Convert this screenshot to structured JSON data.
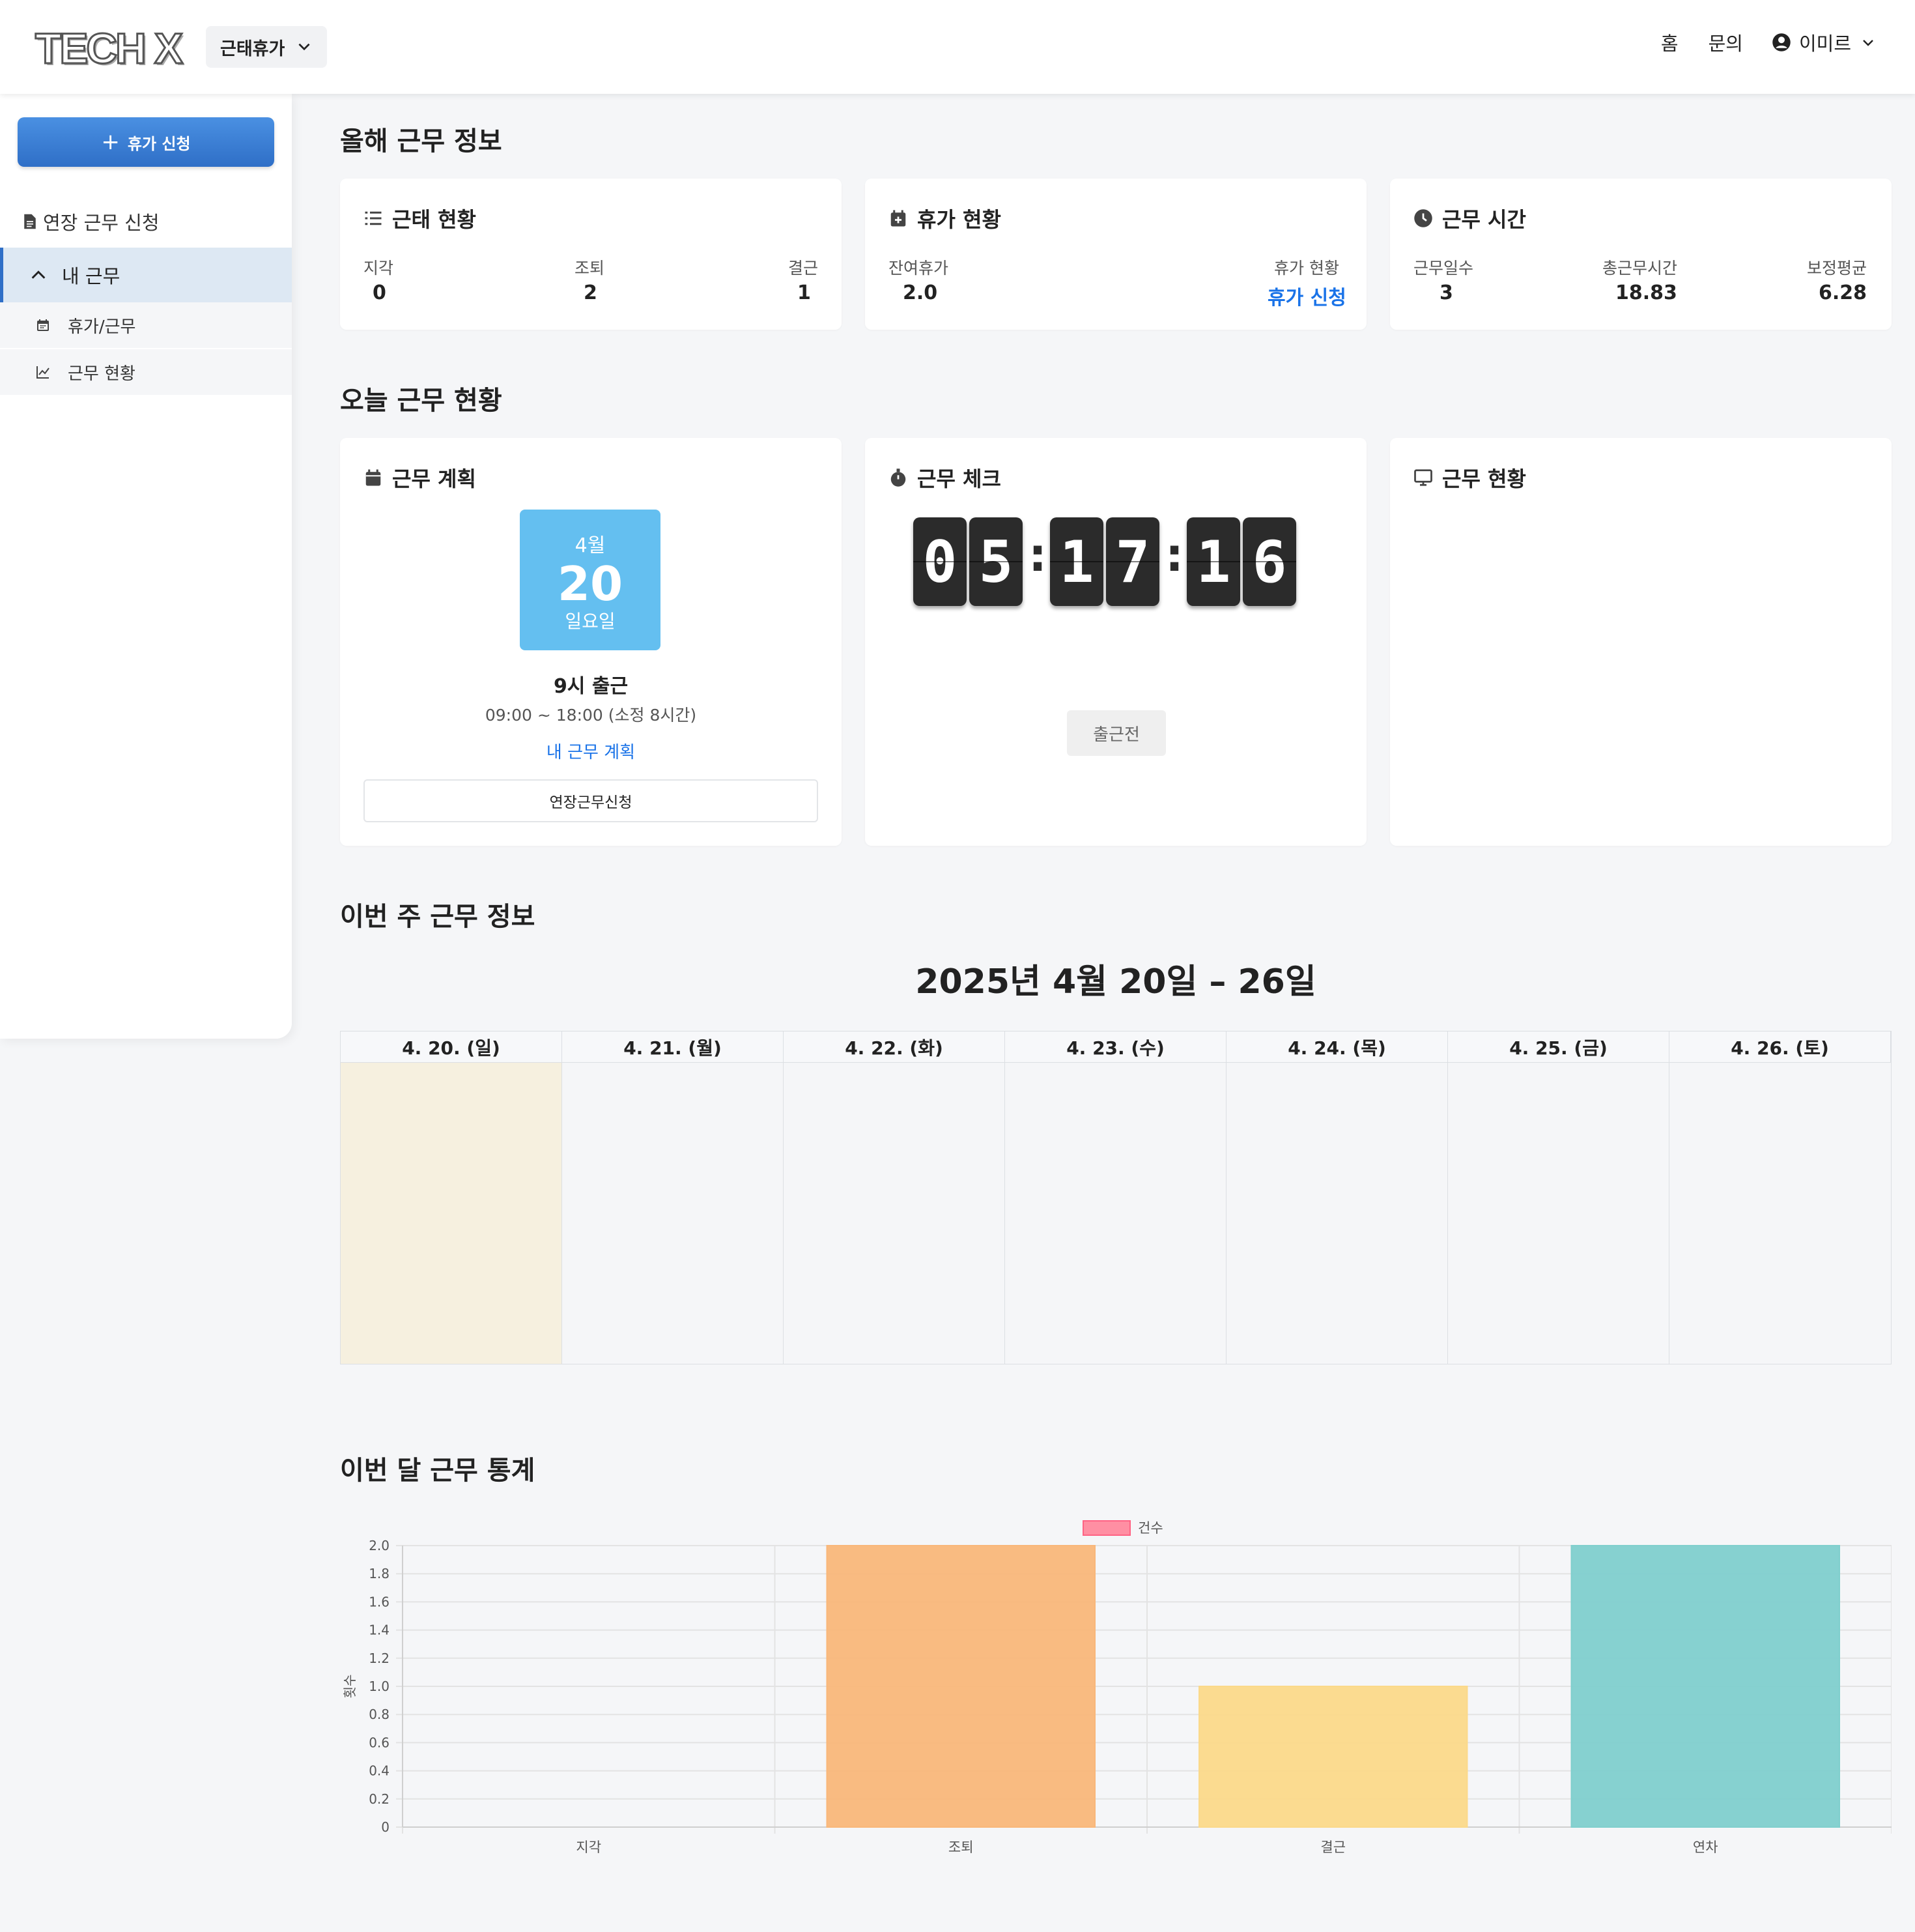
{
  "header": {
    "logo": "TECH X",
    "menu_select": "근태휴가",
    "nav": [
      "홈",
      "문의"
    ],
    "user_name": "이미르"
  },
  "sidebar": {
    "apply_button": "휴가 신청",
    "overtime_item": "연장 근무 신청",
    "group_label": "내 근무",
    "sub_items": [
      "휴가/근무",
      "근무 현황"
    ]
  },
  "yearly": {
    "title": "올해 근무 정보",
    "attendance": {
      "title": "근태 현황",
      "labels": [
        "지각",
        "조퇴",
        "결근"
      ],
      "values": [
        "0",
        "2",
        "1"
      ]
    },
    "leave": {
      "title": "휴가 현황",
      "remaining_label": "잔여휴가",
      "remaining_value": "2.0",
      "status_label": "휴가 현황",
      "status_link": "휴가 신청"
    },
    "hours": {
      "title": "근무 시간",
      "labels": [
        "근무일수",
        "총근무시간",
        "보정평균"
      ],
      "values": [
        "3",
        "18.83",
        "6.28"
      ]
    }
  },
  "today": {
    "title": "오늘 근무 현황",
    "plan": {
      "title": "근무 계획",
      "month": "4월",
      "day": "20",
      "weekday": "일요일",
      "shift": "9시 출근",
      "time": "09:00 ~ 18:00 (소정 8시간)",
      "link": "내 근무 계획",
      "button": "연장근무신청"
    },
    "check": {
      "title": "근무 체크",
      "digits": [
        "0",
        "5",
        "1",
        "7",
        "1",
        "6"
      ],
      "status": "출근전"
    },
    "status": {
      "title": "근무 현황"
    }
  },
  "week": {
    "title": "이번 주 근무 정보",
    "range": "2025년 4월 20일 – 26일",
    "days": [
      "4. 20. (일)",
      "4. 21. (월)",
      "4. 22. (화)",
      "4. 23. (수)",
      "4. 24. (목)",
      "4. 25. (금)",
      "4. 26. (토)"
    ]
  },
  "monthly": {
    "title": "이번 달 근무 통계"
  },
  "chart_data": {
    "type": "bar",
    "categories": [
      "지각",
      "조퇴",
      "결근",
      "연차"
    ],
    "series": [
      {
        "name": "건수",
        "values": [
          0,
          2,
          1,
          2
        ]
      }
    ],
    "colors": [
      "#ff8fa3",
      "#f9b77a",
      "#fbd98a",
      "#80cfcd"
    ],
    "legend_color": "#ff8fa3",
    "ylabel": "횟수",
    "ylim": [
      0,
      2.0
    ],
    "yticks": [
      "0",
      "0.2",
      "0.4",
      "0.6",
      "0.8",
      "1.0",
      "1.2",
      "1.4",
      "1.6",
      "1.8",
      "2.0"
    ],
    "legend_position": "top-center",
    "grid": true
  }
}
